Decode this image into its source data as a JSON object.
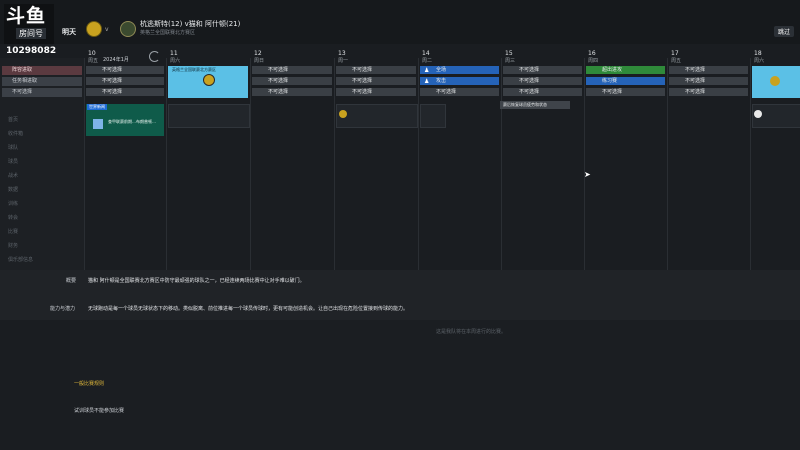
{
  "header": {
    "logo_text": "斗鱼",
    "logo_sub": "房间号",
    "room_id": "10298082",
    "tomorrow": "明天",
    "vs": "v",
    "match_title": "杭逃斯特(12) v猫和 阿什顿(21)",
    "match_sub": "英格兰全国联赛北方赛区",
    "skip_label": "跳过"
  },
  "sidebar": {
    "items": [
      {
        "label": "阵容进取",
        "color": "#5b3a40"
      },
      {
        "label": "任务相进取",
        "color": "#3b4047"
      },
      {
        "label": "不可选择",
        "color": "#3b4047"
      }
    ],
    "dim_items": [
      "首页",
      "收件箱",
      "球队",
      "球员",
      "战术",
      "数据",
      "训练",
      "转会",
      "比赛",
      "财务",
      "俱乐部信息"
    ]
  },
  "calendar": {
    "month_label": "2024年1月",
    "days": [
      {
        "num": "10",
        "day": "周五"
      },
      {
        "num": "11",
        "day": "周六"
      },
      {
        "num": "12",
        "day": "周日"
      },
      {
        "num": "13",
        "day": "周一"
      },
      {
        "num": "14",
        "day": "周二"
      },
      {
        "num": "15",
        "day": "周三"
      },
      {
        "num": "16",
        "day": "周四"
      },
      {
        "num": "17",
        "day": "周五"
      },
      {
        "num": "18",
        "day": "周六"
      }
    ],
    "unavailable": "不可选择",
    "c_team": "全场",
    "c_attack": "攻击",
    "c_opponent_tag": "暴击",
    "c_green": "超出进攻",
    "c_practice": "练习赛",
    "match_card_title": "英格兰全国联赛北方赛区",
    "tooltip": "赛后恢复球员疲劳和状态"
  },
  "news": {
    "tag": "世界新闻",
    "headline": "查甲联赛前期…布朗普顿…"
  },
  "info": {
    "overview_label": "概要",
    "overview_text": "猫和 阿什顿是全国联赛北方赛区中防守最顽强的球队之一，已经连续两场比赛中让对手难以破门。",
    "ability_label": "能力与潜力",
    "ability_text": "无球跑动是每一个球员无球状态下的移动。类似脱离、前位推进每一个球员传球时，更有可能创造机会。让自己出现在危险位置接到传球的能力。"
  },
  "lower": {
    "faint_top": "这是我队将在本周进行的比赛。",
    "section_title": "一般比赛规则",
    "line1": "试训球员不能参加比赛"
  }
}
